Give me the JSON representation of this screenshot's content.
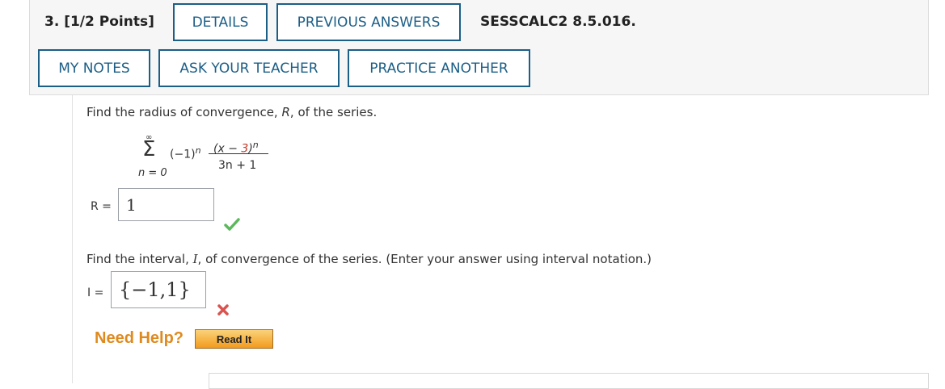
{
  "question": {
    "number_label": "3. [1/2 Points]",
    "code": "SESSCALC2 8.5.016."
  },
  "buttons": {
    "details": "DETAILS",
    "previous_answers": "PREVIOUS ANSWERS",
    "my_notes": "MY NOTES",
    "ask_teacher": "ASK YOUR TEACHER",
    "practice_another": "PRACTICE ANOTHER"
  },
  "part1": {
    "prompt_before": "Find the radius of convergence, ",
    "prompt_var": "R",
    "prompt_after": ", of the series.",
    "series": {
      "sigma_top": "∞",
      "sigma_bottom": "n = 0",
      "factor": "(−1)",
      "factor_exp": "n",
      "numerator": "(x − 3)",
      "numerator_exp": "n",
      "denominator": "3n + 1"
    },
    "answer_label": "R =",
    "answer_value": "1",
    "status": "correct"
  },
  "part2": {
    "prompt_before": "Find the interval, ",
    "prompt_var": "I",
    "prompt_after": ", of convergence of the series. (Enter your answer using interval notation.)",
    "answer_label": "I =",
    "answer_value": "{−1,1}",
    "status": "incorrect"
  },
  "help": {
    "need_help": "Need Help?",
    "read_it": "Read It"
  },
  "colors": {
    "button_border": "#1b5e86",
    "correct": "#5cb85c",
    "incorrect": "#d9534f",
    "help": "#e08a1e"
  }
}
